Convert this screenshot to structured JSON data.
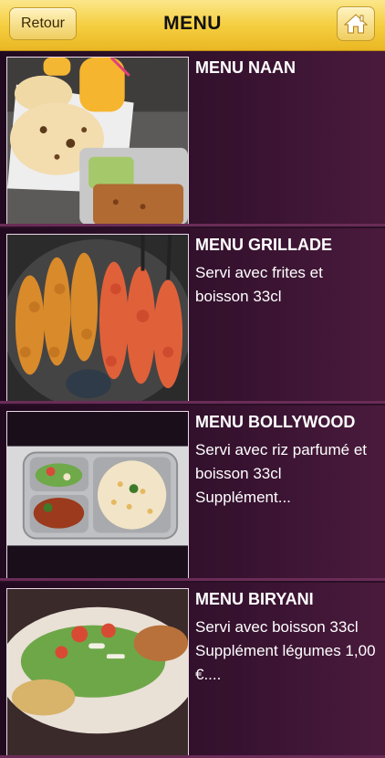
{
  "header": {
    "back_label": "Retour",
    "title": "MENU",
    "home_icon": "home-icon"
  },
  "colors": {
    "header_gold": "#f5cf41",
    "row_background": "#36122f",
    "text": "#ffffff"
  },
  "menu_items": [
    {
      "title": "MENU NAAN",
      "description": "",
      "image": "naan-photo"
    },
    {
      "title": "MENU GRILLADE",
      "description": "Servi avec frites et boisson 33cl",
      "image": "grill-skewers-photo"
    },
    {
      "title": "MENU BOLLYWOOD",
      "description": "Servi avec riz parfumé et boisson 33cl Supplément...",
      "image": "bollywood-plate-photo"
    },
    {
      "title": "MENU BIRYANI",
      "description": "Servi avec boisson 33cl Supplément légumes 1,00 €....",
      "image": "biryani-photo"
    }
  ]
}
